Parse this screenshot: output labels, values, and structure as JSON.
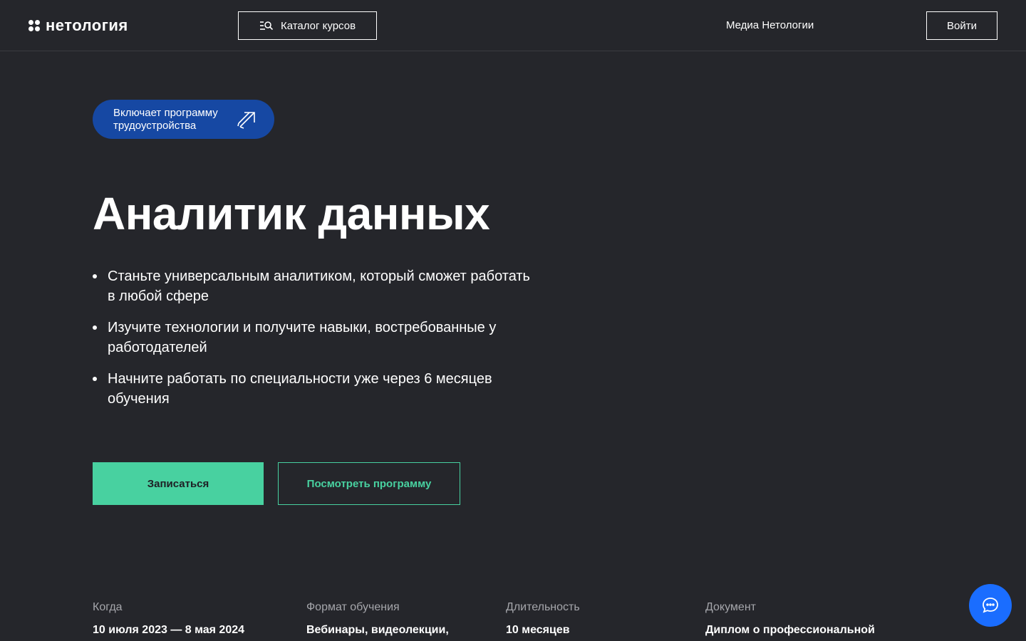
{
  "header": {
    "logo_text": "нетология",
    "catalog_label": "Каталог курсов",
    "media_label": "Медиа Нетологии",
    "login_label": "Войти"
  },
  "hero": {
    "badge_text": "Включает программу трудоустройства",
    "title": "Аналитик данных",
    "bullets": [
      "Станьте универсальным аналитиком, который сможет работать в любой сфере",
      "Изучите технологии и получите навыки, востребованные у работодателей",
      "Начните работать по специальности уже через 6 месяцев обучения"
    ],
    "primary_button": "Записаться",
    "secondary_button": "Посмотреть программу"
  },
  "info": [
    {
      "label": "Когда",
      "value": "10 июля 2023 — 8 мая 2024"
    },
    {
      "label": "Формат обучения",
      "value": "Вебинары, видеолекции,"
    },
    {
      "label": "Длительность",
      "value": "10 месяцев"
    },
    {
      "label": "Документ",
      "value": "Диплом о профессиональной"
    }
  ],
  "colors": {
    "background": "#25262b",
    "accent_green": "#48d1a0",
    "badge_blue": "#1648a3",
    "chat_blue": "#1a6dff"
  },
  "icons": {
    "logo": "four-dots-logo-icon",
    "catalog": "list-search-icon",
    "badge": "arrow-up-right-icon",
    "chat": "chat-bubble-icon"
  }
}
